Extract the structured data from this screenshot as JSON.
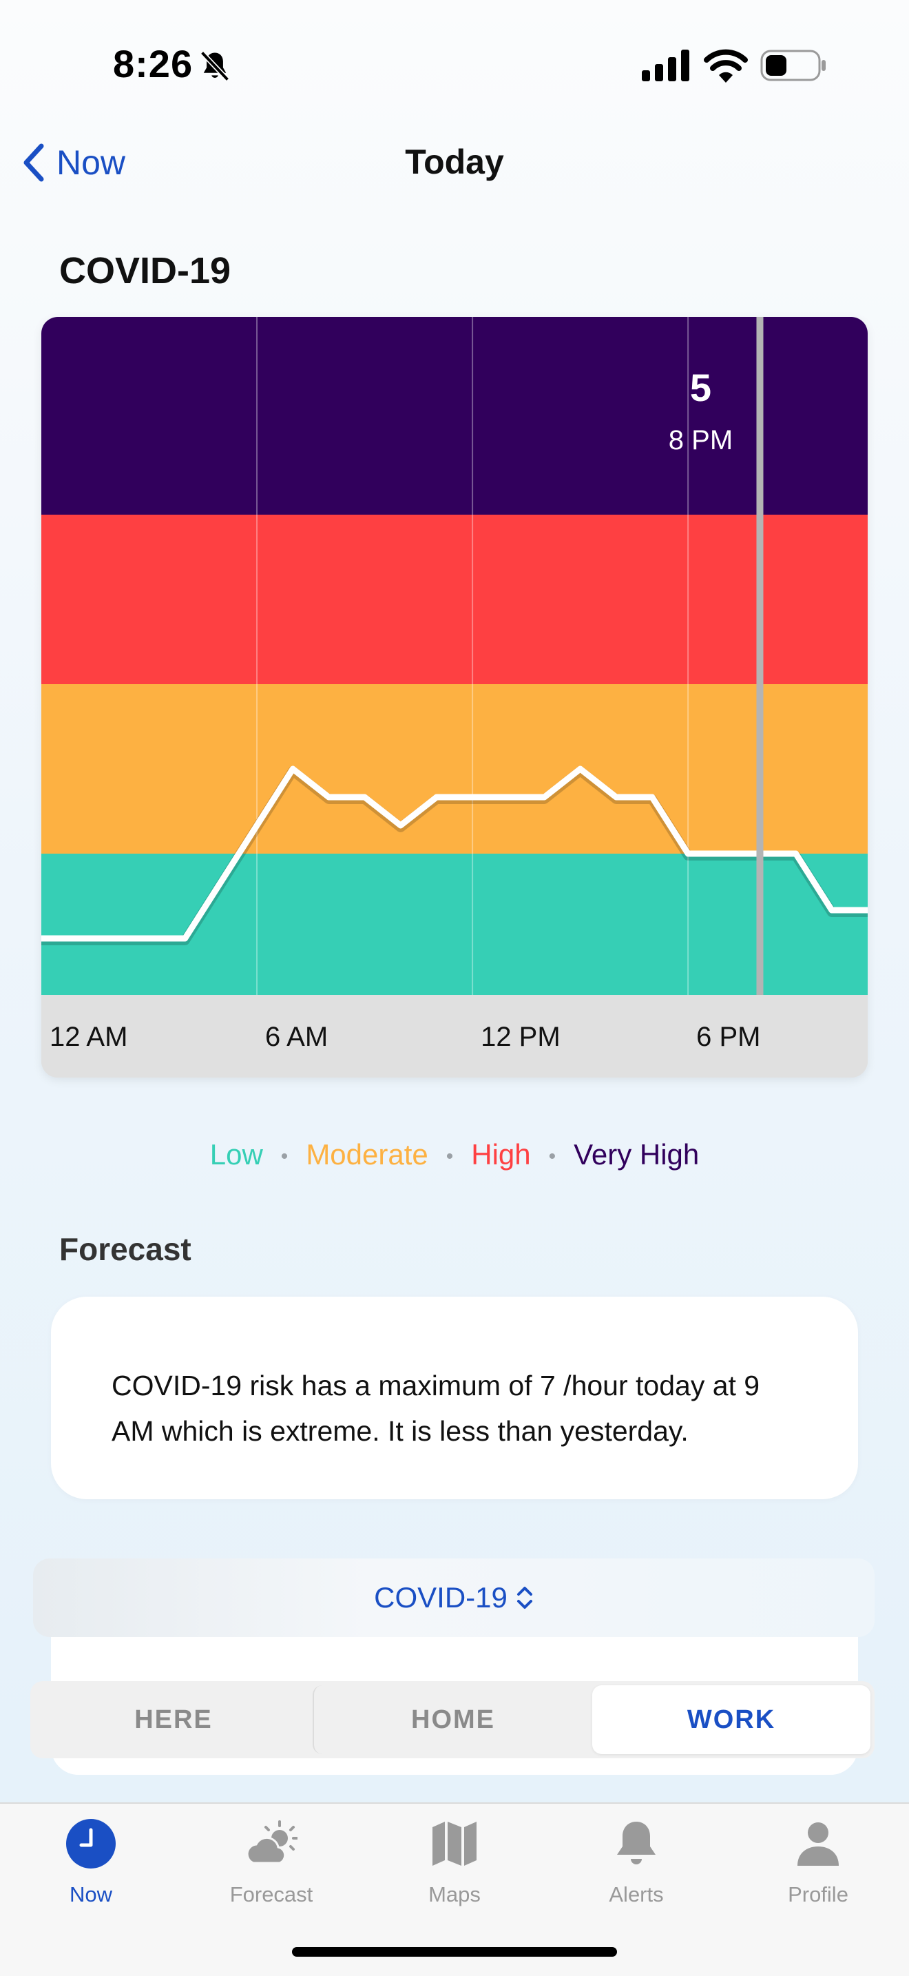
{
  "status_bar": {
    "time": "8:26"
  },
  "nav": {
    "back_label": "Now",
    "title": "Today"
  },
  "section_title": "COVID-19",
  "chart_data": {
    "type": "line",
    "x_tick_labels": [
      "12 AM",
      "6 AM",
      "12 PM",
      "6 PM"
    ],
    "x": [
      0,
      1,
      2,
      3,
      4,
      5,
      6,
      7,
      8,
      9,
      10,
      11,
      12,
      13,
      14,
      15,
      16,
      17,
      18,
      19,
      20,
      21,
      22,
      23
    ],
    "y": [
      1,
      1,
      1,
      1,
      1,
      2,
      3,
      4,
      3.5,
      3.5,
      3,
      3.5,
      3.5,
      3.5,
      3.5,
      4,
      3.5,
      3.5,
      2.5,
      2.5,
      2.5,
      2.5,
      1.5,
      1.5
    ],
    "ylim": [
      0,
      12
    ],
    "x_range": [
      0,
      23
    ],
    "bands": [
      {
        "name": "Low",
        "from": 0,
        "to": 2.5,
        "color": "#36cfb5"
      },
      {
        "name": "Moderate",
        "from": 2.5,
        "to": 5.5,
        "color": "#fdb142"
      },
      {
        "name": "High",
        "from": 5.5,
        "to": 8.5,
        "color": "#fe4042"
      },
      {
        "name": "Very High",
        "from": 8.5,
        "to": 12,
        "color": "#31005c"
      }
    ],
    "selected": {
      "x": 20,
      "value": "5",
      "label": "8 PM"
    },
    "grid": true
  },
  "legend": [
    {
      "label": "Low",
      "color": "#36cfb5"
    },
    {
      "label": "Moderate",
      "color": "#fdb142"
    },
    {
      "label": "High",
      "color": "#fe4042"
    },
    {
      "label": "Very High",
      "color": "#31005c"
    }
  ],
  "forecast": {
    "heading": "Forecast",
    "text": "COVID-19 risk has a maximum of 7 /hour today at 9 AM which is extreme. It is less than yesterday."
  },
  "selector": {
    "label": "COVID-19"
  },
  "locations": [
    {
      "label": "HERE",
      "active": false
    },
    {
      "label": "HOME",
      "active": false
    },
    {
      "label": "WORK",
      "active": true
    }
  ],
  "tabs": [
    {
      "label": "Now",
      "icon": "clock-icon",
      "active": true
    },
    {
      "label": "Forecast",
      "icon": "partly-cloudy-icon",
      "active": false
    },
    {
      "label": "Maps",
      "icon": "map-icon",
      "active": false
    },
    {
      "label": "Alerts",
      "icon": "bell-icon",
      "active": false
    },
    {
      "label": "Profile",
      "icon": "person-icon",
      "active": false
    }
  ],
  "colors": {
    "accent": "#1a4fc4",
    "inactive": "#999999"
  }
}
